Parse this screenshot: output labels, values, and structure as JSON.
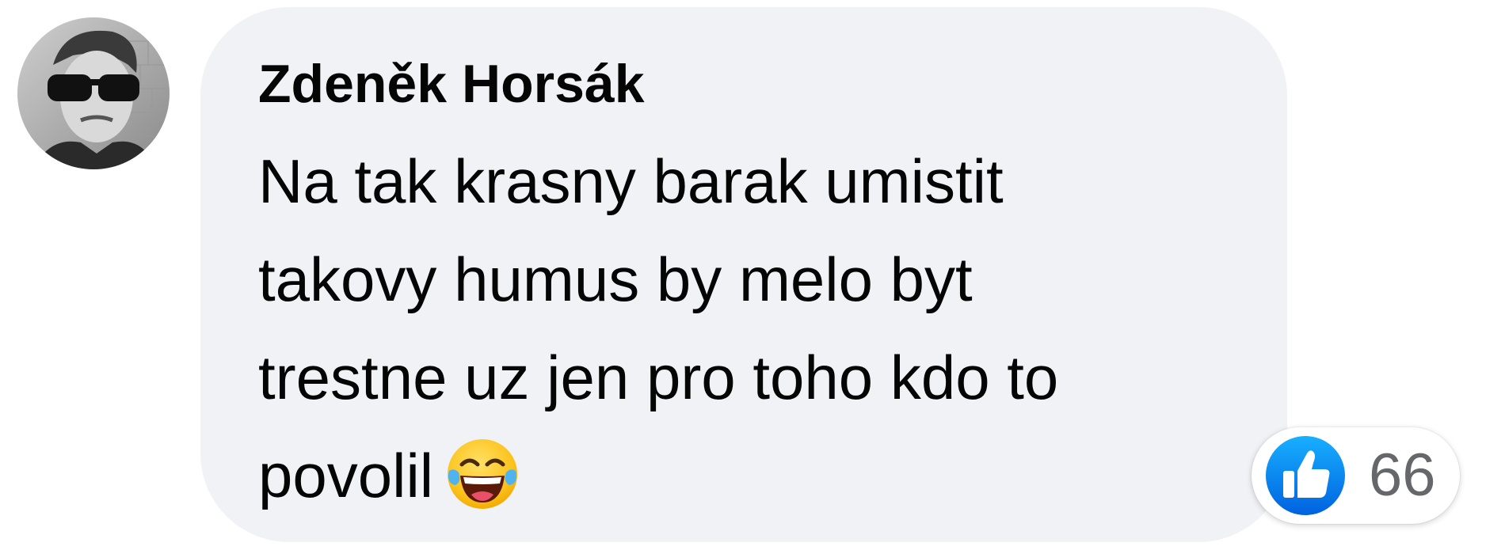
{
  "comment": {
    "author": "Zdeněk Horsák",
    "text_lines": [
      "Na tak krasny barak umistit",
      "takovy humus by melo byt",
      "trestne uz jen pro toho kdo to",
      "povolil"
    ],
    "emoji": "face-with-tears-of-joy",
    "reactions": {
      "icon": "like-thumbs-up-icon",
      "count": "66"
    }
  },
  "colors": {
    "bubble": "#f0f2f5",
    "text": "#050505",
    "like_blue": "#1877f2",
    "count": "#65676b"
  }
}
